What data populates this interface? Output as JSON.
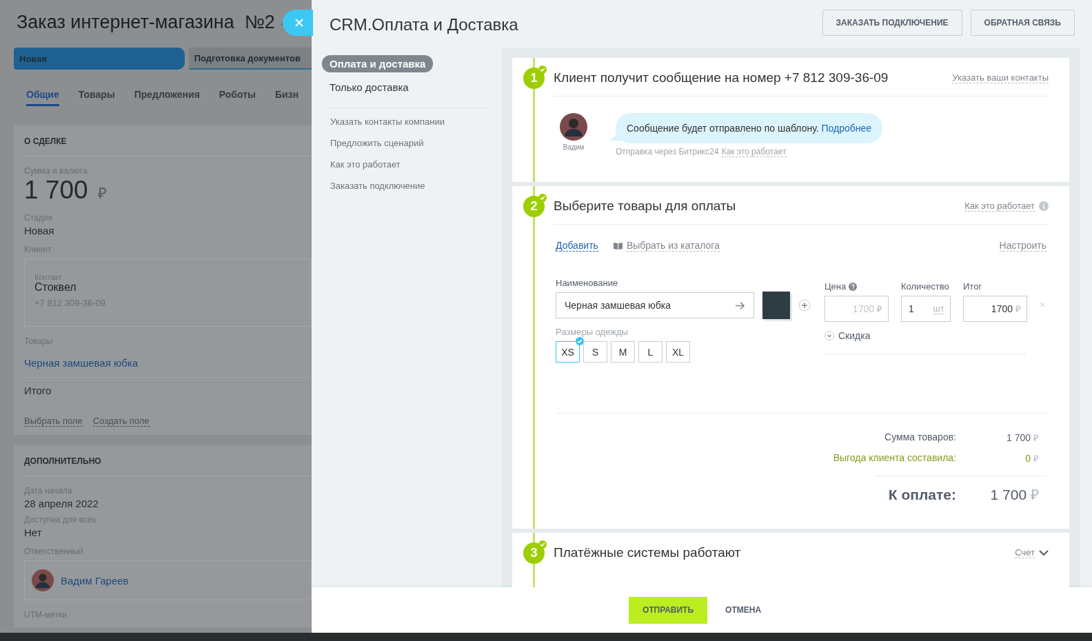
{
  "deal_page": {
    "title": "Заказ интернет-магазина  №2",
    "stages": [
      {
        "label": "Новая",
        "selected": true
      },
      {
        "label": "Подготовка документов",
        "selected": false
      }
    ],
    "tabs": [
      {
        "label": "Общие",
        "selected": true
      },
      {
        "label": "Товары",
        "selected": false
      },
      {
        "label": "Предложения",
        "selected": false
      },
      {
        "label": "Роботы",
        "selected": false
      },
      {
        "label": "Бизн",
        "selected": false
      }
    ],
    "about": {
      "heading": "О СДЕЛКЕ",
      "amount_label": "Сумма и валюта",
      "amount": "1 700",
      "currency": "₽",
      "stage_label": "Стадия",
      "stage": "Новая",
      "client_label": "Клиент",
      "contact_label": "Контакт",
      "contact_name": "Стоквел",
      "contact_phone": "+7 812 309-36-09",
      "products_label": "Товары",
      "product": "Черная замшевая юбка",
      "total_label": "Итого",
      "links": [
        "Выбрать поле",
        "Создать поле"
      ]
    },
    "extra": {
      "heading": "ДОПОЛНИТЕЛЬНО",
      "fields": [
        {
          "label": "Дата начала",
          "value": "28 апреля 2022"
        },
        {
          "label": "Доступна для всех",
          "value": "Нет"
        }
      ],
      "responsible_label": "Ответственный",
      "responsible": "Вадим Гареев",
      "utm_label": "UTM-метки"
    }
  },
  "slider": {
    "title": "CRM.Оплата и Доставка",
    "header_buttons": [
      "ЗАКАЗАТЬ ПОДКЛЮЧЕНИЕ",
      "ОБРАТНАЯ СВЯЗЬ"
    ],
    "nav": [
      {
        "label": "Оплата и доставка",
        "selected": true
      },
      {
        "label": "Только доставка",
        "selected": false
      }
    ],
    "nav_links": [
      "Указать контакты компании",
      "Предложить сценарий",
      "Как это работает",
      "Заказать подключение"
    ],
    "steps": [
      {
        "kind": "message",
        "number": "1",
        "done": true,
        "title": "Клиент получит сообщение на номер +7 812 309-36-09",
        "action": "Указать ваши контакты",
        "sender": "Вадим",
        "bubble": "Сообщение будет отправлено по шаблону.",
        "bubble_link": "Подробнее",
        "note": "Отправка через Битрикс24",
        "note_link": "Как это работает"
      },
      {
        "kind": "products",
        "number": "2",
        "done": true,
        "title": "Выберите товары для оплаты",
        "action": "Как это работает",
        "add": "Добавить",
        "catalog": "Выбрать из каталога",
        "configure": "Настроить",
        "product": {
          "name_label": "Наименование",
          "name": "Черная замшевая юбка",
          "variation_label": "Размеры одежды",
          "sizes": [
            {
              "label": "XS",
              "selected": true
            },
            {
              "label": "S",
              "selected": false
            },
            {
              "label": "M",
              "selected": false
            },
            {
              "label": "L",
              "selected": false
            },
            {
              "label": "XL",
              "selected": false
            }
          ],
          "price_label": "Цена",
          "price": "1700",
          "price_disabled": true,
          "qty_label": "Количество",
          "qty": "1",
          "unit": "шт",
          "total_label": "Итог",
          "total": "1700",
          "currency": "₽",
          "discount": "Скидка"
        },
        "summary": [
          {
            "kind": "normal",
            "label": "Сумма товаров:",
            "value": "1 700"
          },
          {
            "kind": "benefit",
            "label": "Выгода клиента составила:",
            "value": "0"
          }
        ],
        "due_label": "К оплате:",
        "due": "1 700",
        "currency": "₽"
      },
      {
        "kind": "collapsed",
        "number": "3",
        "done": true,
        "title": "Платёжные системы работают",
        "action": "Счет"
      }
    ],
    "footer_buttons": [
      {
        "kind": "primary",
        "label": "ОТПРАВИТЬ"
      },
      {
        "kind": "plain",
        "label": "ОТМЕНА"
      }
    ]
  }
}
